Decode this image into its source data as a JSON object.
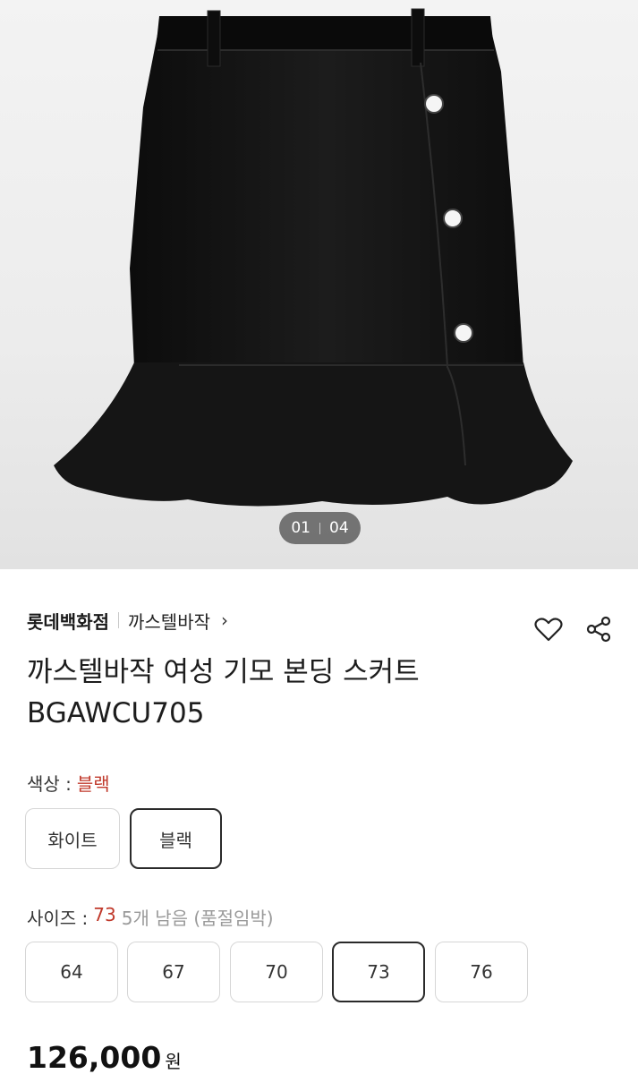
{
  "gallery": {
    "current": "01",
    "total": "04"
  },
  "store": {
    "name": "롯데백화점",
    "brand": "까스텔바작"
  },
  "product": {
    "title": "까스텔바작 여성 기모 본딩 스커트 BGAWCU705"
  },
  "color_option": {
    "label": "색상 :",
    "selected": "블랙",
    "choices": [
      "화이트",
      "블랙"
    ]
  },
  "size_option": {
    "label": "사이즈 :",
    "selected": "73",
    "stock_note": "5개 남음 (품절임박)",
    "choices": [
      "64",
      "67",
      "70",
      "73",
      "76"
    ]
  },
  "price": {
    "amount": "126,000",
    "unit": "원"
  },
  "colors": {
    "accent_red": "#c0392b",
    "skirt": "#111111"
  }
}
